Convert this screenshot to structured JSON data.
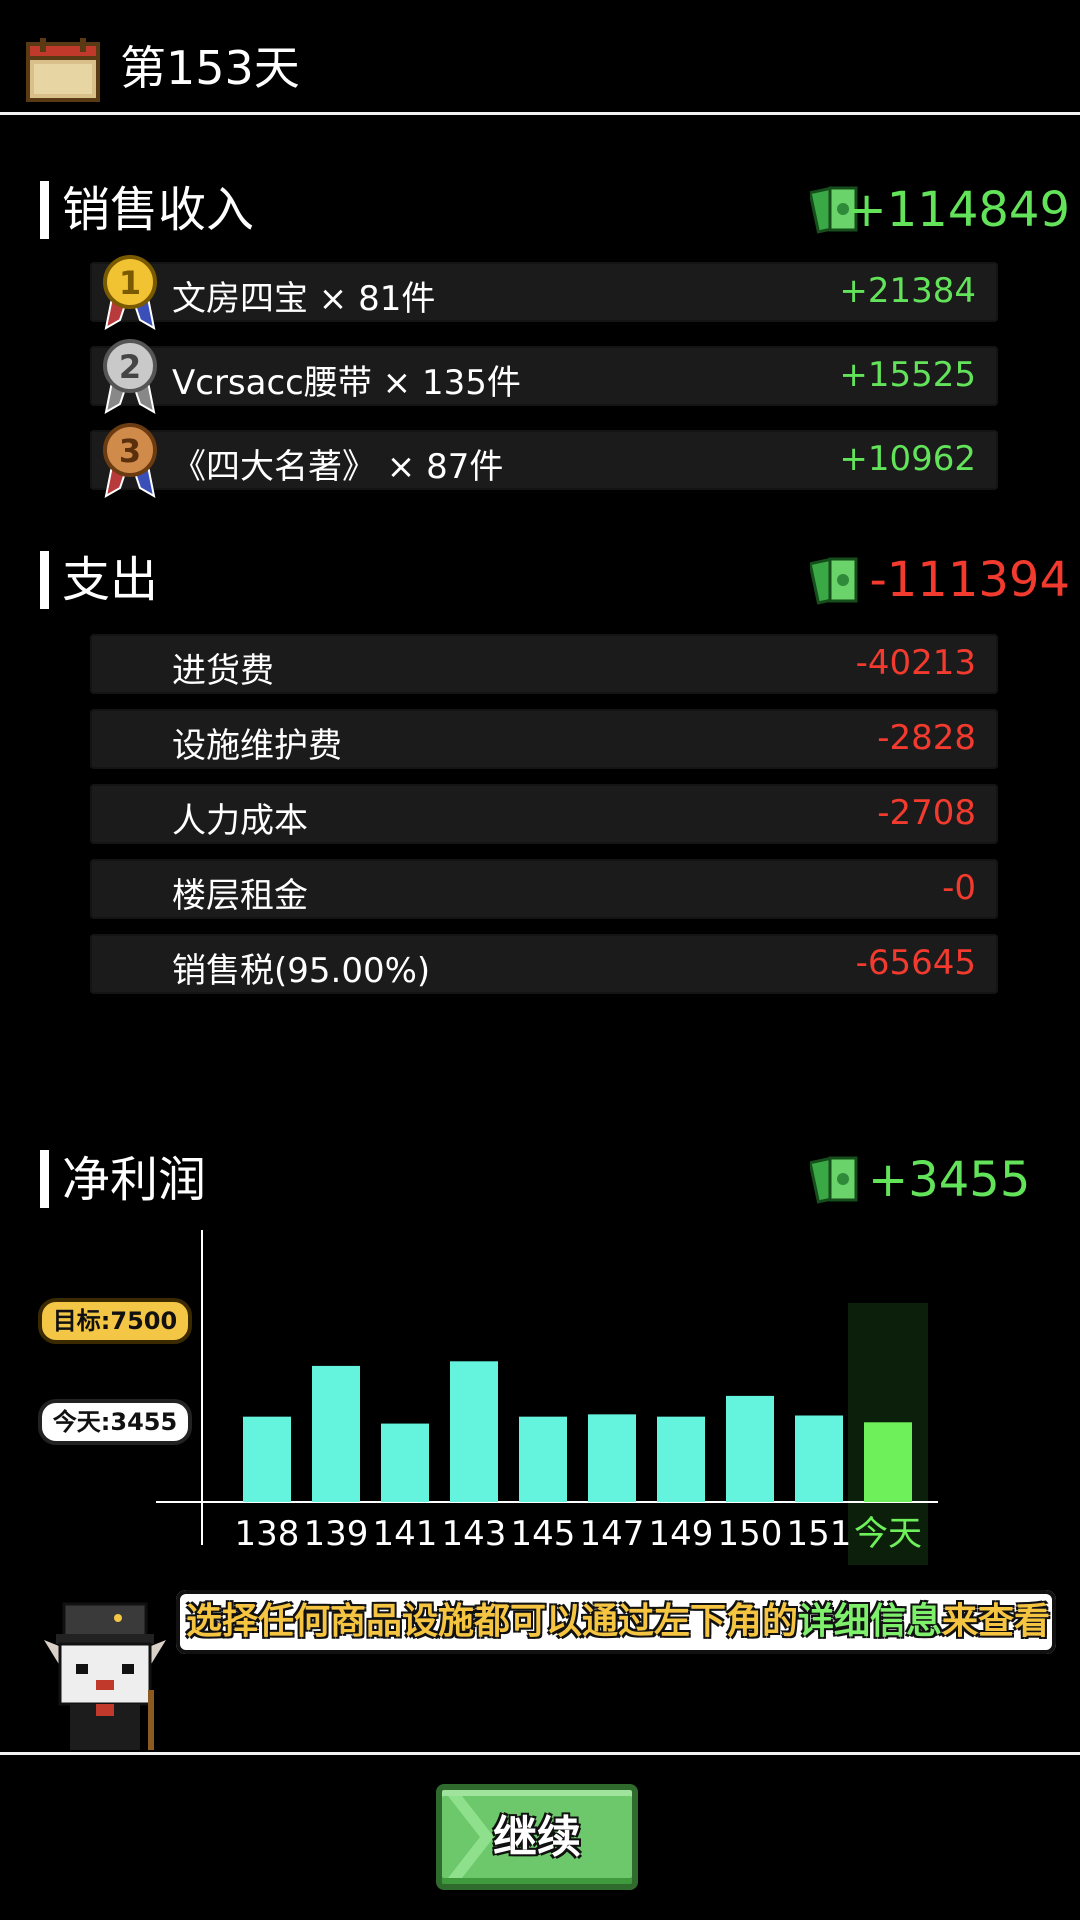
{
  "header": {
    "day_title": "第153天"
  },
  "sales": {
    "title": "销售收入",
    "total": "+114849",
    "items": [
      {
        "rank": "1",
        "label": "文房四宝 × 81件",
        "value": "+21384"
      },
      {
        "rank": "2",
        "label": "Vcrsacc腰带 × 135件",
        "value": "+15525"
      },
      {
        "rank": "3",
        "label": "《四大名著》 × 87件",
        "value": "+10962"
      }
    ]
  },
  "expenses": {
    "title": "支出",
    "total": "-111394",
    "items": [
      {
        "label": "进货费",
        "value": "-40213"
      },
      {
        "label": "设施维护费",
        "value": "-2828"
      },
      {
        "label": "人力成本",
        "value": "-2708"
      },
      {
        "label": "楼层租金",
        "value": "-0"
      },
      {
        "label": "销售税(95.00%)",
        "value": "-65645"
      }
    ]
  },
  "profit": {
    "title": "净利润",
    "total": "+3455",
    "target_label": "目标:7500",
    "today_label": "今天:3455"
  },
  "chart_data": {
    "type": "bar",
    "categories": [
      "138",
      "139",
      "141",
      "143",
      "145",
      "147",
      "149",
      "150",
      "151",
      "今天"
    ],
    "values": [
      3700,
      5900,
      3400,
      6100,
      3700,
      3800,
      3700,
      4600,
      3750,
      3455
    ],
    "target": 7500,
    "highlight": "今天",
    "colors": {
      "bar": "#64f4de",
      "today_bar": "#6ef05a",
      "today_bg": "#0c1f0a"
    }
  },
  "tip": {
    "part_a": "选择任何商品设施都可以通过左下角的",
    "part_b": "详细信息",
    "part_c": "来查看"
  },
  "footer": {
    "continue_label": "继续"
  },
  "colors": {
    "positive": "#62e35a",
    "negative": "#f23a2e",
    "accent": "#f4c646"
  }
}
